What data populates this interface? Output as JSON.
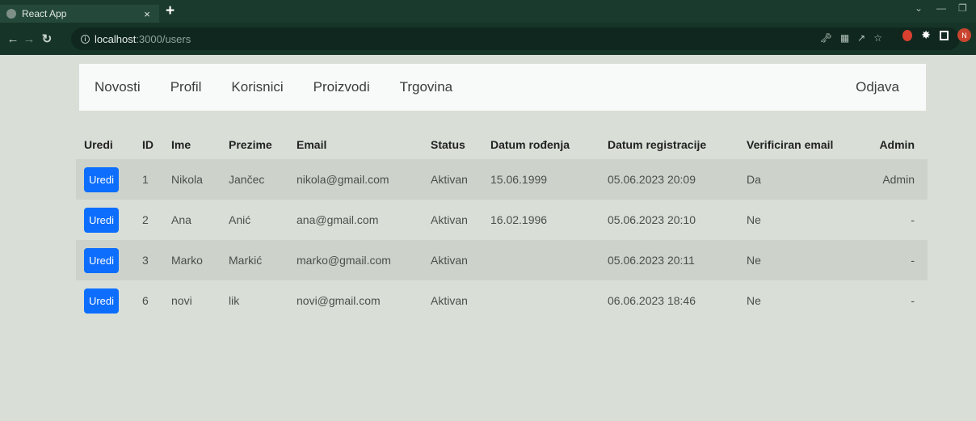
{
  "browser": {
    "tab_title": "React App",
    "tab_close": "×",
    "new_tab": "+",
    "url_host": "localhost",
    "url_path": ":3000/users",
    "profile_initial": "N"
  },
  "navbar": {
    "links": [
      "Novosti",
      "Profil",
      "Korisnici",
      "Proizvodi",
      "Trgovina"
    ],
    "logout": "Odjava"
  },
  "table": {
    "headers": [
      "Uredi",
      "ID",
      "Ime",
      "Prezime",
      "Email",
      "Status",
      "Datum rođenja",
      "Datum registracije",
      "Verificiran email",
      "Admin"
    ],
    "edit_label": "Uredi",
    "rows": [
      {
        "id": "1",
        "ime": "Nikola",
        "prezime": "Jančec",
        "email": "nikola@gmail.com",
        "status": "Aktivan",
        "datum_rodjenja": "15.06.1999",
        "datum_registracije": "05.06.2023 20:09",
        "verificiran": "Da",
        "admin": "Admin"
      },
      {
        "id": "2",
        "ime": "Ana",
        "prezime": "Anić",
        "email": "ana@gmail.com",
        "status": "Aktivan",
        "datum_rodjenja": "16.02.1996",
        "datum_registracije": "05.06.2023 20:10",
        "verificiran": "Ne",
        "admin": "-"
      },
      {
        "id": "3",
        "ime": "Marko",
        "prezime": "Markić",
        "email": "marko@gmail.com",
        "status": "Aktivan",
        "datum_rodjenja": "",
        "datum_registracije": "05.06.2023 20:11",
        "verificiran": "Ne",
        "admin": "-"
      },
      {
        "id": "6",
        "ime": "novi",
        "prezime": "lik",
        "email": "novi@gmail.com",
        "status": "Aktivan",
        "datum_rodjenja": "",
        "datum_registracije": "06.06.2023 18:46",
        "verificiran": "Ne",
        "admin": "-"
      }
    ]
  }
}
